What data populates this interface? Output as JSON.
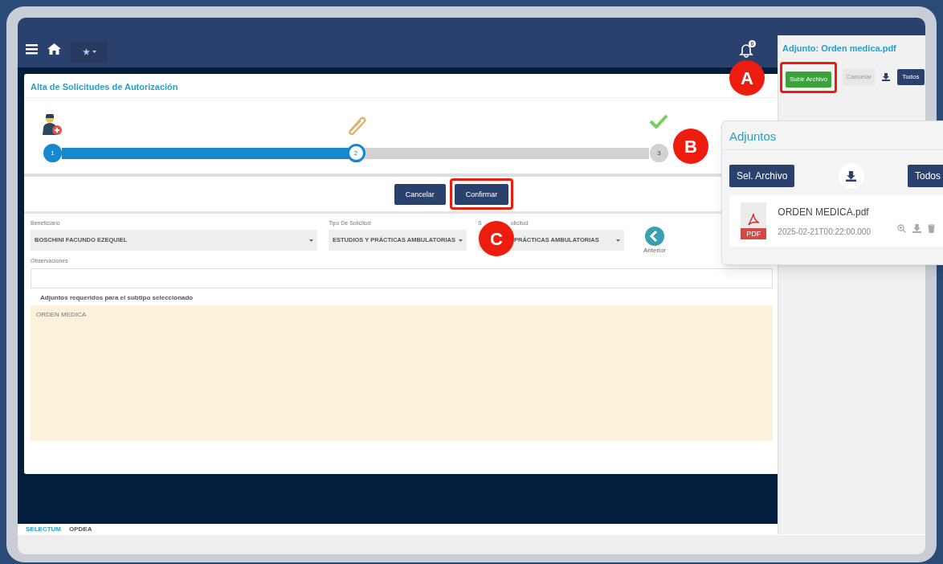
{
  "navbar": {
    "notifications_badge": "0"
  },
  "page": {
    "title": "Alta de Solicitudes de Autorización"
  },
  "stepper": {
    "level": 0.5,
    "steps": [
      {
        "number": "1",
        "kind": "user",
        "done": true,
        "selected": false
      },
      {
        "number": "2",
        "kind": "clip",
        "done": false,
        "selected": true
      },
      {
        "number": "3",
        "kind": "check",
        "done": false,
        "selected": false
      }
    ]
  },
  "actions": [
    {
      "label": "Cancelar",
      "highlighted": false
    },
    {
      "label": "Confirmar",
      "highlighted": true
    }
  ],
  "form": {
    "selects": [
      {
        "label_parts": [
          "Beneficiario"
        ],
        "value": "BOSCHINI FACUNDO EZEQUIEL"
      },
      {
        "label_parts": [
          "Tipo De Solicitud"
        ],
        "value": "ESTUDIOS Y PRÁCTICAS AMBULATORIAS"
      },
      {
        "label_parts": [
          "S",
          "olicitud"
        ],
        "value": "PRÁCTICAS AMBULATORIAS"
      }
    ],
    "back_button": "Anterior",
    "observations_label": "Observaciones",
    "required_heading": "Adjuntos requeridos para el subtipo seleccionado",
    "required_items": [
      "ORDEN MEDICA"
    ]
  },
  "footer": [
    "SELECTUM",
    "OPDEA"
  ],
  "attachment_panel": {
    "title": "Adjunto: Orden medica.pdf",
    "buttons": [
      {
        "kind": "upload",
        "label": "Subir Archivo",
        "highlighted": true
      },
      {
        "kind": "cancel",
        "label": "Cancelar",
        "highlighted": false
      },
      {
        "kind": "download",
        "highlighted": false
      },
      {
        "kind": "all",
        "label": "Todos",
        "highlighted": false
      }
    ]
  },
  "attachments_popup": {
    "title": "Adjuntos",
    "select_button": "Sel. Archivo",
    "all_button": "Todos",
    "files": [
      {
        "name": "ORDEN MEDICA.pdf",
        "date": "2025-02-21T00:22:00.000",
        "type_label": "PDF"
      }
    ]
  },
  "markers": [
    {
      "letter": "A"
    },
    {
      "letter": "B"
    },
    {
      "letter": "C"
    }
  ]
}
